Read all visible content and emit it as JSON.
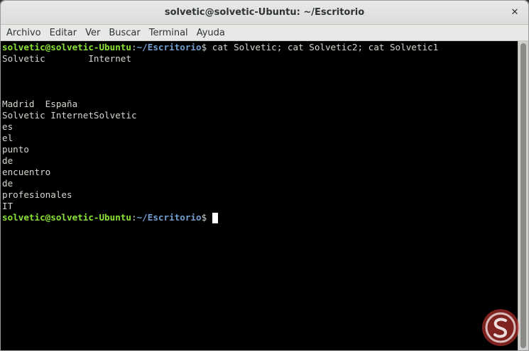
{
  "window": {
    "title": "solvetic@solvetic-Ubuntu: ~/Escritorio",
    "close_glyph": "✕"
  },
  "menu": [
    "Archivo",
    "Editar",
    "Ver",
    "Buscar",
    "Terminal",
    "Ayuda"
  ],
  "prompt": {
    "user_host": "solvetic@solvetic-Ubuntu",
    "colon": ":",
    "path": "~/Escritorio",
    "dollar": "$"
  },
  "command": " cat Solvetic; cat Solvetic2; cat Solvetic1",
  "output": [
    "Solvetic        Internet",
    "",
    "",
    "",
    "Madrid  España",
    "Solvetic InternetSolvetic",
    "es",
    "el",
    "punto",
    "de",
    "encuentro",
    "de",
    "profesionales",
    "IT"
  ],
  "colors": {
    "terminal_bg": "#000000",
    "text": "#d3d7cf",
    "user_host": "#8ae234",
    "path": "#729fcf",
    "watermark": "#e8403c"
  },
  "icons": {
    "close": "close-icon",
    "watermark": "solvetic-logo-icon"
  }
}
